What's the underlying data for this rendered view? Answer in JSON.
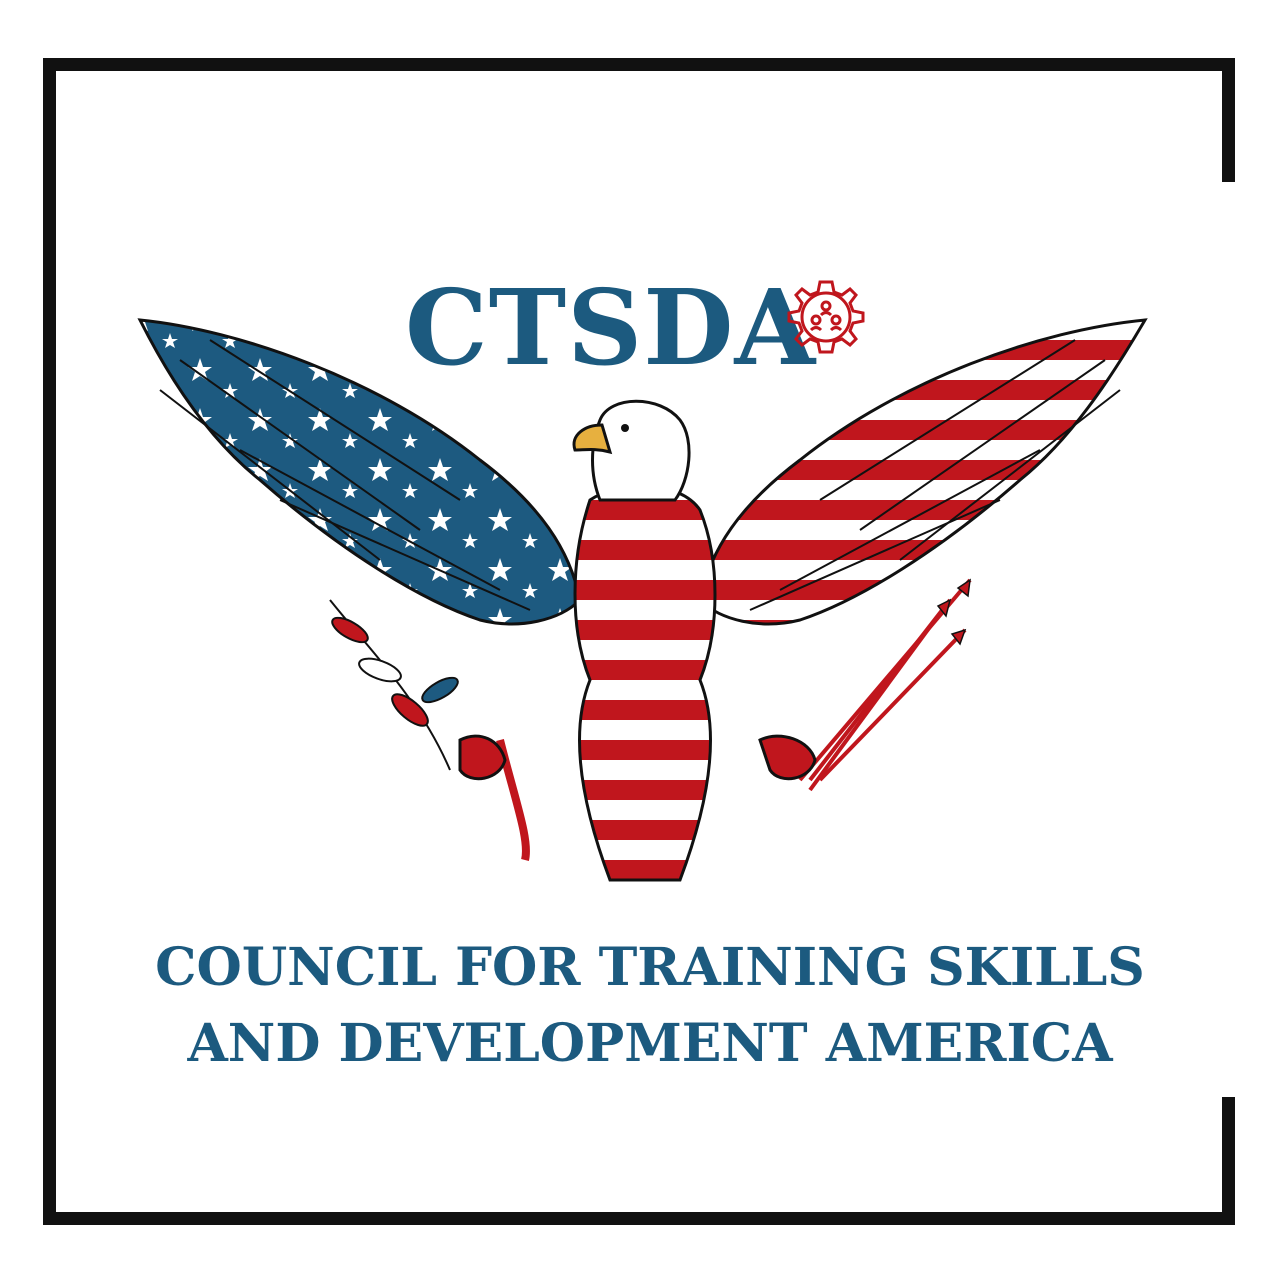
{
  "logo": {
    "acronym": "CTSDA",
    "icon": "gear-people-icon",
    "emblem_icon": "eagle-flag-emblem-icon"
  },
  "org_name": {
    "line1": "COUNCIL FOR TRAINING SKILLS",
    "line2": "AND DEVELOPMENT AMERICA"
  },
  "colors": {
    "brand_blue": "#1c5a7f",
    "flag_red": "#c0161d",
    "flag_blue": "#1d5a80",
    "beak_gold": "#e7b03f",
    "frame": "#111111",
    "background": "#ffffff"
  }
}
